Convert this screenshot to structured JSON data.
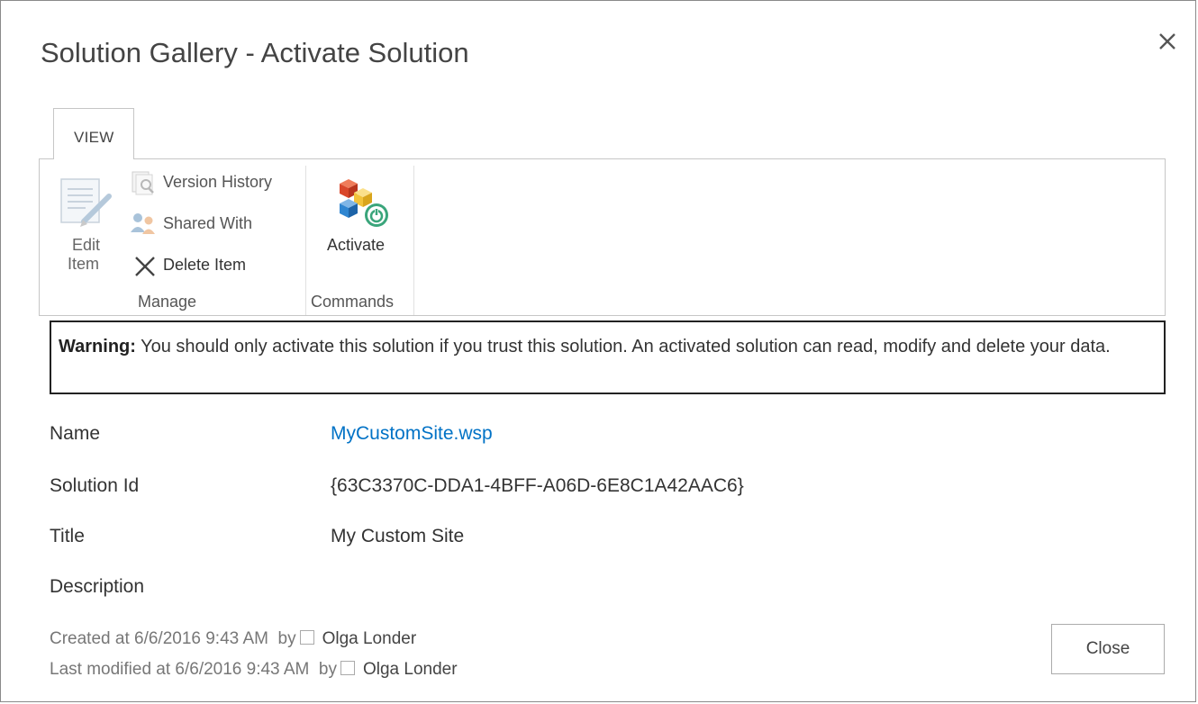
{
  "dialog": {
    "title": "Solution Gallery - Activate Solution"
  },
  "ribbon": {
    "tab_label": "VIEW",
    "manage_group": {
      "label": "Manage",
      "edit_item_line1": "Edit",
      "edit_item_line2": "Item",
      "version_history": "Version History",
      "shared_with": "Shared With",
      "delete_item": "Delete Item"
    },
    "commands_group": {
      "label": "Commands",
      "activate": "Activate"
    }
  },
  "warning": {
    "prefix": "Warning:",
    "text": " You should only activate this solution if you trust this solution. An activated solution can read, modify and delete your data."
  },
  "fields": {
    "name_label": "Name",
    "name_value": "MyCustomSite.wsp",
    "solution_id_label": "Solution Id",
    "solution_id_value": "{63C3370C-DDA1-4BFF-A06D-6E8C1A42AAC6}",
    "title_label": "Title",
    "title_value": "My Custom Site",
    "description_label": "Description"
  },
  "meta": {
    "created": "Created at 6/6/2016 9:43 AM  by",
    "created_by": "Olga Londer",
    "modified": "Last modified at 6/6/2016 9:43 AM  by",
    "modified_by": "Olga Londer"
  },
  "buttons": {
    "close": "Close"
  },
  "icons": {
    "close": "close-x-icon",
    "edit_item": "edit-page-icon",
    "version_history": "version-history-icon",
    "shared_with": "shared-users-icon",
    "delete": "delete-x-icon",
    "activate": "activate-solution-icon"
  }
}
